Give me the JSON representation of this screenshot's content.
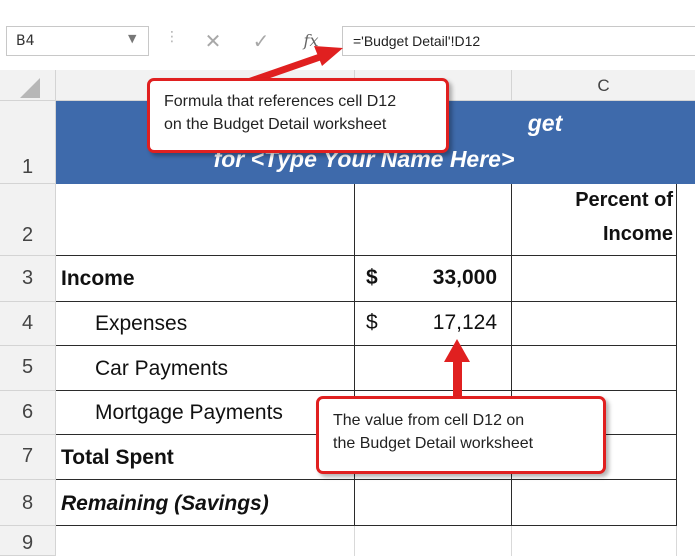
{
  "formula_bar": {
    "name_box": "B4",
    "cancel_icon": "✕",
    "enter_icon": "✓",
    "fx_label": "fx",
    "formula": "='Budget Detail'!D12"
  },
  "columns": [
    "C"
  ],
  "rows": [
    {
      "num": "1"
    },
    {
      "num": "2"
    },
    {
      "num": "3"
    },
    {
      "num": "4"
    },
    {
      "num": "5"
    },
    {
      "num": "6"
    },
    {
      "num": "7"
    },
    {
      "num": "8"
    },
    {
      "num": "9"
    }
  ],
  "title": {
    "line1": "get",
    "line2": "for <Type Your Name Here>"
  },
  "header_row": {
    "percent_line1": "Percent of",
    "percent_line2": "Income"
  },
  "labels": {
    "income": "Income",
    "expenses": "Expenses",
    "car_payments": "Car Payments",
    "mortgage_payments": "Mortgage Payments",
    "total_spent": "Total Spent",
    "remaining": "Remaining (Savings)"
  },
  "values": {
    "income_currency": "$",
    "income_amount": "33,000",
    "expenses_currency": "$",
    "expenses_amount": "17,124"
  },
  "callouts": {
    "formula_line1": "Formula that references cell D12",
    "formula_line2": "on the Budget Detail worksheet",
    "value_line1": "The value from cell D12 on",
    "value_line2": "the Budget Detail worksheet"
  },
  "colors": {
    "title_band": "#3e6aab",
    "callout_border": "#e02020"
  }
}
